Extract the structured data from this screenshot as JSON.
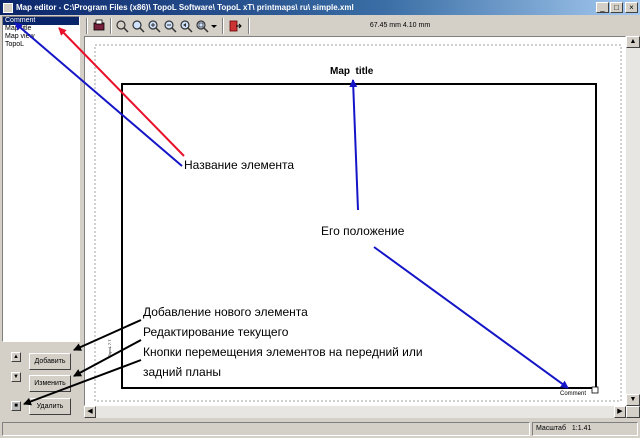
{
  "window": {
    "title": "Map editor - C:\\Program Files (x86)\\ TopoL Software\\ TopoL xT\\ printmaps\\ ru\\ simple.xml"
  },
  "element_list": {
    "items": [
      "Comment",
      "Map title",
      "Map view",
      "TopoL"
    ],
    "selected_index": 0
  },
  "toolbar": {
    "coords": "67.45 mm  4.10 mm",
    "icons": [
      "print-icon",
      "pointer-icon",
      "zoom-icon",
      "zoom-in-icon",
      "zoom-out-icon",
      "zoom-prev-icon",
      "zoom-page-icon",
      "zoom-dropdown-icon",
      "exit-icon"
    ]
  },
  "canvas": {
    "map_title": "Map  title",
    "comment": "Comment",
    "side_text": "TopoL 7.7"
  },
  "buttons": {
    "add": "Добавить",
    "edit": "Изменить",
    "delete": "Удалить"
  },
  "status": {
    "scale_label": "Масштаб",
    "scale_value": "1:1.41"
  },
  "annotations": {
    "element_name": "Название элемента",
    "position": "Его положение",
    "add_new": "Добавление нового элемента",
    "edit_current": "Редактирование текущего",
    "order_line1": "Кнопки перемещения элементов на передний или",
    "order_line2": "задний планы"
  },
  "colors": {
    "red_arrow": "#e8102a",
    "blue_arrow": "#1515c8",
    "black_arrow": "#000000"
  }
}
